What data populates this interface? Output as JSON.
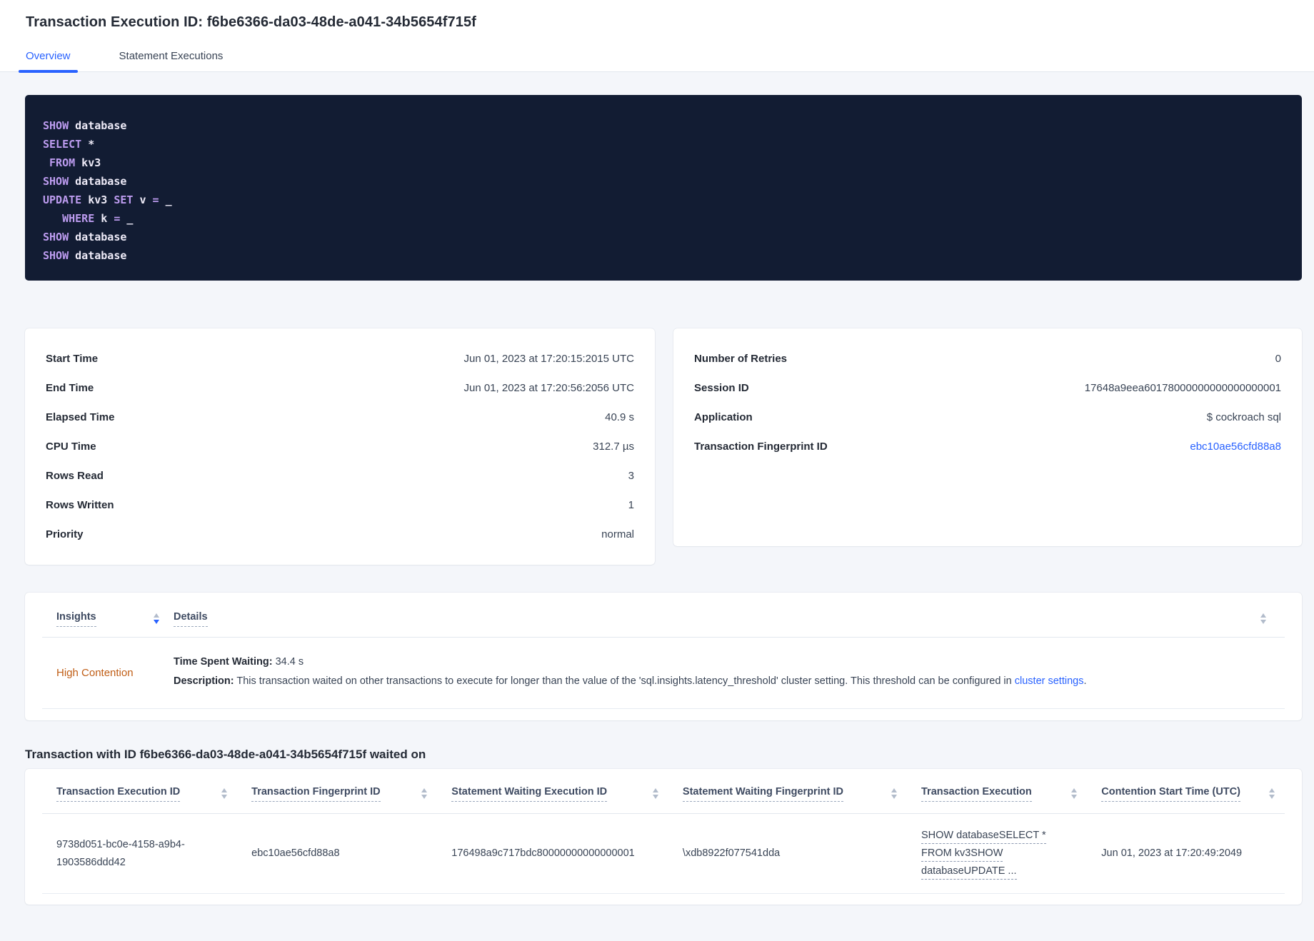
{
  "page": {
    "title": "Transaction Execution ID: f6be6366-da03-48de-a041-34b5654f715f"
  },
  "tabs": [
    {
      "label": "Overview",
      "active": true
    },
    {
      "label": "Statement Executions",
      "active": false
    }
  ],
  "sql": {
    "lines": [
      {
        "tokens": [
          {
            "t": "kw",
            "s": "SHOW"
          },
          {
            "t": "pl",
            "s": " database"
          }
        ]
      },
      {
        "tokens": [
          {
            "t": "kw",
            "s": "SELECT"
          },
          {
            "t": "pl",
            "s": " *"
          }
        ]
      },
      {
        "tokens": [
          {
            "t": "pl",
            "s": " "
          },
          {
            "t": "kw",
            "s": "FROM"
          },
          {
            "t": "pl",
            "s": " kv3"
          }
        ]
      },
      {
        "tokens": [
          {
            "t": "kw",
            "s": "SHOW"
          },
          {
            "t": "pl",
            "s": " database"
          }
        ]
      },
      {
        "tokens": [
          {
            "t": "kw",
            "s": "UPDATE"
          },
          {
            "t": "pl",
            "s": " kv3 "
          },
          {
            "t": "kw",
            "s": "SET"
          },
          {
            "t": "pl",
            "s": " v "
          },
          {
            "t": "kw",
            "s": "="
          },
          {
            "t": "pl",
            "s": " _"
          }
        ]
      },
      {
        "tokens": [
          {
            "t": "pl",
            "s": "   "
          },
          {
            "t": "kw",
            "s": "WHERE"
          },
          {
            "t": "pl",
            "s": " k "
          },
          {
            "t": "kw",
            "s": "="
          },
          {
            "t": "pl",
            "s": " _"
          }
        ]
      },
      {
        "tokens": [
          {
            "t": "kw",
            "s": "SHOW"
          },
          {
            "t": "pl",
            "s": " database"
          }
        ]
      },
      {
        "tokens": [
          {
            "t": "kw",
            "s": "SHOW"
          },
          {
            "t": "pl",
            "s": " database"
          }
        ]
      }
    ]
  },
  "summary_left": {
    "rows": [
      {
        "label": "Start Time",
        "value": "Jun 01, 2023 at 17:20:15:2015 UTC"
      },
      {
        "label": "End Time",
        "value": "Jun 01, 2023 at 17:20:56:2056 UTC"
      },
      {
        "label": "Elapsed Time",
        "value": "40.9 s"
      },
      {
        "label": "CPU Time",
        "value": "312.7 µs"
      },
      {
        "label": "Rows Read",
        "value": "3"
      },
      {
        "label": "Rows Written",
        "value": "1"
      },
      {
        "label": "Priority",
        "value": "normal"
      }
    ]
  },
  "summary_right": {
    "rows": [
      {
        "label": "Number of Retries",
        "value": "0"
      },
      {
        "label": "Session ID",
        "value": "17648a9eea60178000000000000000001"
      },
      {
        "label": "Application",
        "value": "$ cockroach sql"
      },
      {
        "label": "Transaction Fingerprint ID",
        "value": "ebc10ae56cfd88a8",
        "link": true
      }
    ]
  },
  "insights": {
    "columns": [
      {
        "label": "Insights",
        "sorted": "desc"
      },
      {
        "label": "Details"
      }
    ],
    "row": {
      "insight": "High Contention",
      "waiting_label": "Time Spent Waiting:",
      "waiting_value": "34.4 s",
      "description_label": "Description:",
      "description_text": "This transaction waited on other transactions to execute for longer than the value of the 'sql.insights.latency_threshold' cluster setting. This threshold can be configured in ",
      "description_link": "cluster settings",
      "description_suffix": "."
    }
  },
  "waited_section": {
    "title": "Transaction with ID f6be6366-da03-48de-a041-34b5654f715f waited on",
    "columns": [
      {
        "label": "Transaction Execution ID"
      },
      {
        "label": "Transaction Fingerprint ID"
      },
      {
        "label": "Statement Waiting Execution ID"
      },
      {
        "label": "Statement Waiting Fingerprint ID"
      },
      {
        "label": "Transaction Execution"
      },
      {
        "label": "Contention Start Time (UTC)"
      }
    ],
    "row": {
      "transaction_execution_id": "9738d051-bc0e-4158-a9b4-1903586ddd42",
      "transaction_fingerprint_id": "ebc10ae56cfd88a8",
      "statement_waiting_execution_id": "176498a9c717bdc80000000000000001",
      "statement_waiting_fingerprint_id": "\\xdb8922f077541dda",
      "transaction_execution_lines": [
        "SHOW databaseSELECT *",
        "FROM kv3SHOW",
        "databaseUPDATE ..."
      ],
      "contention_start_time": "Jun 01, 2023 at 17:20:49:2049"
    }
  },
  "colors": {
    "accent_blue": "#2962ff",
    "warning_orange": "#c05e16",
    "code_background": "#121c33",
    "code_keyword": "#bd9cf0",
    "code_plain": "#eeebf8",
    "page_background": "#f4f6fa"
  }
}
